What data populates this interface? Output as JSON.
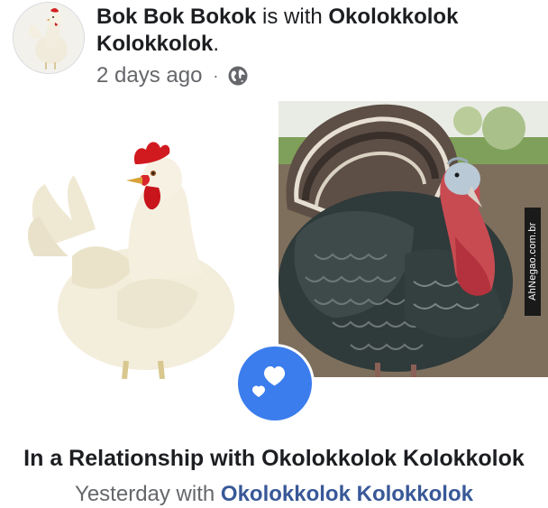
{
  "post": {
    "author": "Bok Bok Bokok",
    "connector": " is with ",
    "tagged": "Okolokkolok Kolokkolok",
    "tagged_suffix": ".",
    "timestamp": "2 days ago",
    "separator": "·",
    "privacy_icon": "globe-icon"
  },
  "photos": {
    "left_subject": "white chicken",
    "right_subject": "turkey",
    "watermark": "AhNegao.com.br"
  },
  "badge": {
    "icon": "hearts-icon",
    "color": "#3b7ded"
  },
  "relationship": {
    "title": "In a Relationship with Okolokkolok Kolokkolok",
    "when": "Yesterday",
    "with_text": " with ",
    "partner": "Okolokkolok Kolokkolok"
  }
}
